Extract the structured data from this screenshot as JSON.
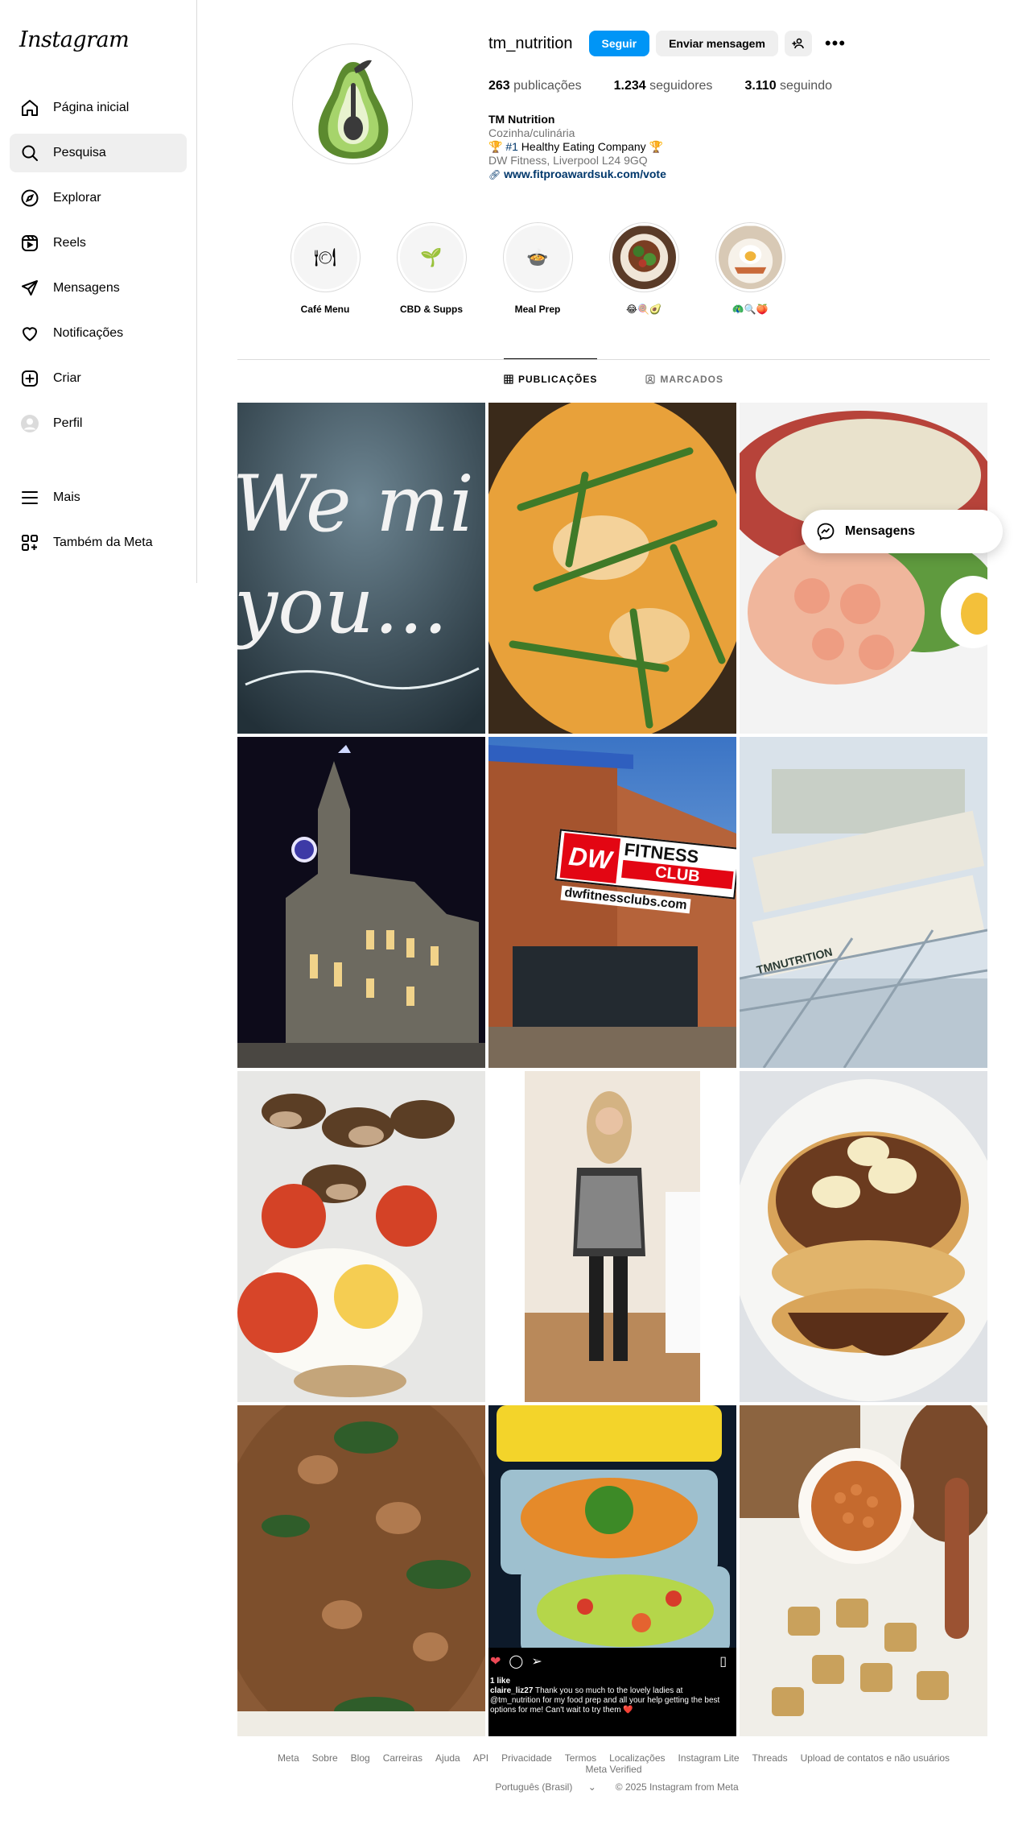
{
  "sidebar": {
    "logo": "Instagram",
    "items": [
      {
        "label": "Página inicial",
        "icon": "home-icon"
      },
      {
        "label": "Pesquisa",
        "icon": "search-icon"
      },
      {
        "label": "Explorar",
        "icon": "compass-icon"
      },
      {
        "label": "Reels",
        "icon": "reels-icon"
      },
      {
        "label": "Mensagens",
        "icon": "send-icon"
      },
      {
        "label": "Notificações",
        "icon": "heart-icon"
      },
      {
        "label": "Criar",
        "icon": "plus-square-icon"
      },
      {
        "label": "Perfil",
        "icon": "avatar-icon"
      }
    ],
    "bottom": [
      {
        "label": "Mais",
        "icon": "menu-icon"
      },
      {
        "label": "Também da Meta",
        "icon": "apps-icon"
      }
    ]
  },
  "profile": {
    "username": "tm_nutrition",
    "follow_label": "Seguir",
    "message_label": "Enviar mensagem",
    "stats": {
      "posts": "263",
      "posts_label": "publicações",
      "followers": "1.234",
      "followers_label": "seguidores",
      "following": "3.110",
      "following_label": "seguindo"
    },
    "bio": {
      "name": "TM Nutrition",
      "category": "Cozinha/culinária",
      "line1_prefix": "🏆 ",
      "line1_tag": "#1",
      "line1_rest": " Healthy Eating Company 🏆",
      "line2": "DW Fitness, Liverpool L24 9GQ",
      "link": "www.fitproawardsuk.com/vote"
    }
  },
  "highlights": [
    {
      "label": "Café Menu",
      "glyph": "🍽"
    },
    {
      "label": "CBD & Supps",
      "glyph": "🌱"
    },
    {
      "label": "Meal Prep",
      "glyph": "🍲"
    },
    {
      "label": "😂🍭🥑",
      "glyph": ""
    },
    {
      "label": "🦚🔍🍑",
      "glyph": ""
    }
  ],
  "tabs": {
    "posts": "PUBLICAÇÕES",
    "tagged": "MARCADOS"
  },
  "tiles": {
    "t1_text_a": "We mi",
    "t1_text_b": "you...",
    "dw_logo": "DW",
    "dw_fitness": "FITNESS",
    "dw_club": "CLUB",
    "dw_url": "dwfitnessclubs.com",
    "tm_label": "TMNUTRITION",
    "comment_likes": "1 like",
    "comment_user": "claire_liz27",
    "comment_text": " Thank you so much to the lovely ladies at @tm_nutrition for my food prep and all your help getting the best options for me! Can't wait to try them ❤️"
  },
  "floating_messages": "Mensagens",
  "footer": {
    "links": [
      "Meta",
      "Sobre",
      "Blog",
      "Carreiras",
      "Ajuda",
      "API",
      "Privacidade",
      "Termos",
      "Localizações",
      "Instagram Lite",
      "Threads",
      "Upload de contatos e não usuários",
      "Meta Verified"
    ],
    "language": "Português (Brasil)",
    "copyright": "© 2025 Instagram from Meta"
  },
  "colors": {
    "accent": "#0095f6",
    "link": "#00376b",
    "muted": "#737373",
    "border": "#dbdbdb"
  }
}
